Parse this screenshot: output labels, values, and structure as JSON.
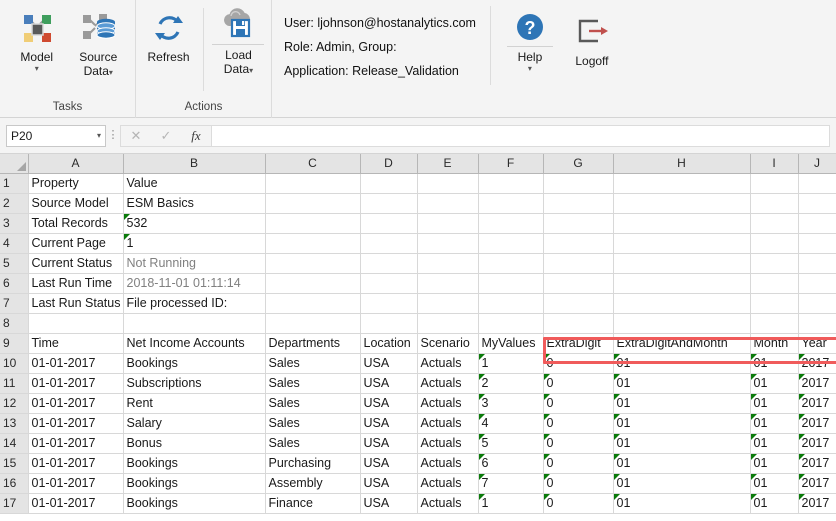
{
  "ribbon": {
    "groups": [
      {
        "name": "Tasks",
        "label": "Tasks",
        "buttons": [
          {
            "label": "Model",
            "icon": "model-nodes-icon",
            "caret": "▾"
          },
          {
            "label": "Source Data",
            "line1": "Source",
            "line2": "Data",
            "icon": "database-source-icon",
            "caret": "▾"
          }
        ]
      },
      {
        "name": "Actions",
        "label": "Actions",
        "buttons": [
          {
            "label": "Refresh",
            "icon": "refresh-icon",
            "caret": ""
          },
          {
            "label": "Load Data",
            "line1": "Load",
            "line2": "Data",
            "icon": "cloud-save-icon",
            "caret": "▾"
          }
        ]
      }
    ],
    "info": {
      "user": "User: ljohnson@hostanalytics.com",
      "role": "Role: Admin, Group:",
      "application": "Application: Release_Validation"
    },
    "help": {
      "label": "Help",
      "icon": "help-question-icon",
      "caret": "▾"
    },
    "logoff": {
      "label": "Logoff",
      "icon": "logoff-arrow-icon"
    }
  },
  "formula_bar": {
    "name_box_value": "P20",
    "name_box_caret": "▾",
    "cancel_icon": "✕",
    "confirm_icon": "✓",
    "fx_icon": "fx",
    "formula_value": ""
  },
  "grid": {
    "column_headers": [
      "A",
      "B",
      "C",
      "D",
      "E",
      "F",
      "G",
      "H",
      "I",
      "J"
    ],
    "property_table": {
      "header": {
        "row": "1",
        "property": "Property",
        "value": "Value"
      },
      "rows": [
        {
          "row": "2",
          "property": "Source Model",
          "value": "ESM Basics",
          "style": "normal",
          "flag": false
        },
        {
          "row": "3",
          "property": "Total Records",
          "value": "532",
          "style": "normal",
          "flag": true
        },
        {
          "row": "4",
          "property": "Current Page",
          "value": "1",
          "style": "normal",
          "flag": true
        },
        {
          "row": "5",
          "property": "Current Status",
          "value": "Not Running",
          "style": "gray",
          "flag": false
        },
        {
          "row": "6",
          "property": "Last Run Time",
          "value": "2018-11-01 01:11:14",
          "style": "gray",
          "flag": false
        },
        {
          "row": "7",
          "property": "Last Run Status",
          "value": "File processed ID:",
          "style": "normal",
          "flag": false
        }
      ],
      "blank_row": "8"
    },
    "data_table": {
      "header_row": "9",
      "columns": [
        "Time",
        "Net Income Accounts",
        "Departments",
        "Location",
        "Scenario",
        "MyValues",
        "ExtraDigit",
        "ExtraDigitAndMonth",
        "Month",
        "Year"
      ],
      "rows": [
        {
          "row": "10",
          "cells": [
            "01-01-2017",
            "Bookings",
            "Sales",
            "USA",
            "Actuals",
            "1",
            "0",
            "01",
            "01",
            "2017"
          ]
        },
        {
          "row": "11",
          "cells": [
            "01-01-2017",
            "Subscriptions",
            "Sales",
            "USA",
            "Actuals",
            "2",
            "0",
            "01",
            "01",
            "2017"
          ]
        },
        {
          "row": "12",
          "cells": [
            "01-01-2017",
            "Rent",
            "Sales",
            "USA",
            "Actuals",
            "3",
            "0",
            "01",
            "01",
            "2017"
          ]
        },
        {
          "row": "13",
          "cells": [
            "01-01-2017",
            "Salary",
            "Sales",
            "USA",
            "Actuals",
            "4",
            "0",
            "01",
            "01",
            "2017"
          ]
        },
        {
          "row": "14",
          "cells": [
            "01-01-2017",
            "Bonus",
            "Sales",
            "USA",
            "Actuals",
            "5",
            "0",
            "01",
            "01",
            "2017"
          ]
        },
        {
          "row": "15",
          "cells": [
            "01-01-2017",
            "Bookings",
            "Purchasing",
            "USA",
            "Actuals",
            "6",
            "0",
            "01",
            "01",
            "2017"
          ]
        },
        {
          "row": "16",
          "cells": [
            "01-01-2017",
            "Bookings",
            "Assembly",
            "USA",
            "Actuals",
            "7",
            "0",
            "01",
            "01",
            "2017"
          ]
        },
        {
          "row": "17",
          "cells": [
            "01-01-2017",
            "Bookings",
            "Finance",
            "USA",
            "Actuals",
            "1",
            "0",
            "01",
            "01",
            "2017"
          ]
        }
      ],
      "flag_columns": [
        5,
        6,
        7,
        8,
        9
      ]
    },
    "highlight": {
      "name": "red-highlight-box",
      "color": "#f05b5b"
    }
  }
}
